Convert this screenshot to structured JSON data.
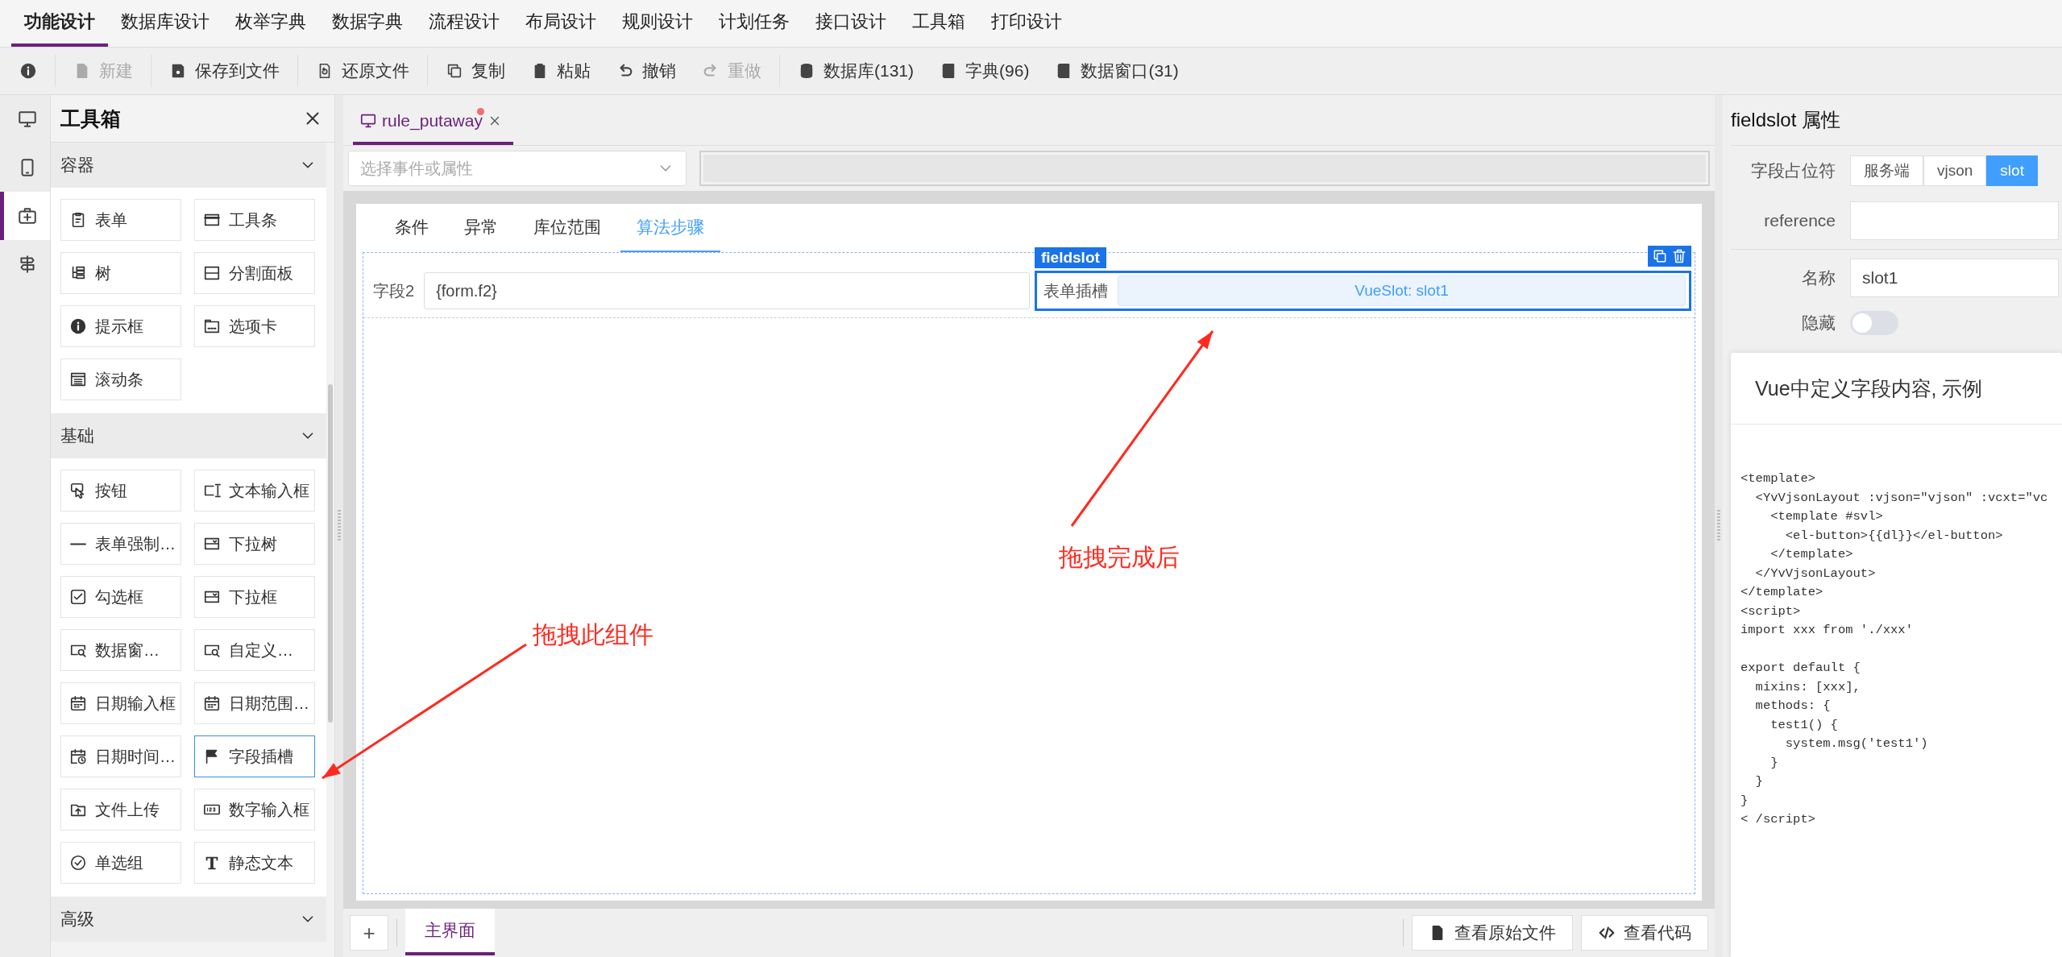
{
  "menu": [
    {
      "label": "功能设计",
      "selected": true
    },
    {
      "label": "数据库设计",
      "selected": false
    },
    {
      "label": "枚举字典",
      "selected": false
    },
    {
      "label": "数据字典",
      "selected": false
    },
    {
      "label": "流程设计",
      "selected": false
    },
    {
      "label": "布局设计",
      "selected": false
    },
    {
      "label": "规则设计",
      "selected": false
    },
    {
      "label": "计划任务",
      "selected": false
    },
    {
      "label": "接口设计",
      "selected": false
    },
    {
      "label": "工具箱",
      "selected": false
    },
    {
      "label": "打印设计",
      "selected": false
    }
  ],
  "toolbar": [
    [
      {
        "disabled": false
      }
    ],
    [
      {
        "label": "新建",
        "disabled": true
      }
    ],
    [
      {
        "label": "保存到文件",
        "disabled": false
      }
    ],
    [
      {
        "label": "还原文件",
        "disabled": false
      }
    ],
    [
      {
        "label": "复制",
        "disabled": false
      },
      {
        "label": "粘贴",
        "disabled": false
      },
      {
        "label": "撤销",
        "disabled": false
      },
      {
        "label": "重做",
        "disabled": true
      }
    ],
    [
      {
        "label": "数据库(131)",
        "disabled": false
      },
      {
        "label": "字典(96)",
        "disabled": false
      },
      {
        "label": "数据窗口(31)",
        "disabled": false
      }
    ]
  ],
  "side_strip": [
    {
      "selected": false
    },
    {
      "selected": false
    },
    {
      "selected": true
    },
    {
      "selected": false
    }
  ],
  "toolbox": {
    "title": "工具箱",
    "sections": [
      {
        "title": "容器",
        "expanded": true,
        "items": [
          {
            "label": "表单",
            "selected": false
          },
          {
            "label": "工具条",
            "selected": false
          },
          {
            "label": "树",
            "selected": false
          },
          {
            "label": "分割面板",
            "selected": false
          },
          {
            "label": "提示框",
            "selected": false
          },
          {
            "label": "选项卡",
            "selected": false
          },
          {
            "label": "滚动条",
            "selected": false
          }
        ]
      },
      {
        "title": "基础",
        "expanded": true,
        "items": [
          {
            "label": "按钮",
            "selected": false
          },
          {
            "label": "文本输入框",
            "selected": false
          },
          {
            "label": "表单强制…",
            "selected": false
          },
          {
            "label": "下拉树",
            "selected": false
          },
          {
            "label": "勾选框",
            "selected": false
          },
          {
            "label": "下拉框",
            "selected": false
          },
          {
            "label": "数据窗…",
            "selected": false
          },
          {
            "label": "自定义…",
            "selected": false
          },
          {
            "label": "日期输入框",
            "selected": false
          },
          {
            "label": "日期范围…",
            "selected": false
          },
          {
            "label": "日期时间…",
            "selected": false
          },
          {
            "label": "字段插槽",
            "selected": true
          },
          {
            "label": "文件上传",
            "selected": false
          },
          {
            "label": "数字输入框",
            "selected": false
          },
          {
            "label": "单选组",
            "selected": false
          },
          {
            "label": "静态文本",
            "selected": false
          }
        ]
      },
      {
        "title": "高级",
        "expanded": true
      }
    ]
  },
  "doc_tabs": [
    {
      "label": "rule_putaway",
      "modified": true,
      "selected": true
    }
  ],
  "event_select": {
    "placeholder": "选择事件或属性"
  },
  "form_tabs": [
    {
      "label": "条件",
      "selected": false
    },
    {
      "label": "异常",
      "selected": false
    },
    {
      "label": "库位范围",
      "selected": false
    },
    {
      "label": "算法步骤",
      "selected": true
    }
  ],
  "form_row": {
    "field": {
      "label": "字段2",
      "value": "{form.f2}"
    },
    "slot": {
      "tag": "fieldslot",
      "label": "表单插槽",
      "value": "VueSlot: slot1",
      "selected": true
    }
  },
  "properties": {
    "title": "fieldslot 属性",
    "placeholder_type": {
      "label": "字段占位符",
      "options": [
        {
          "label": "服务端",
          "selected": false
        },
        {
          "label": "vjson",
          "selected": false
        },
        {
          "label": "slot",
          "selected": true
        }
      ]
    },
    "reference": {
      "label": "reference"
    },
    "name": {
      "label": "名称",
      "value": "slot1"
    },
    "hidden": {
      "label": "隐藏",
      "on": false
    }
  },
  "help": {
    "title": "Vue中定义字段内容, 示例",
    "code": "<template>\n  <YvVjsonLayout :vjson=\"vjson\" :vcxt=\"vc\n    <template #svl>\n      <el-button>{{dl}}</el-button>\n    </template>\n  </YvVjsonLayout>\n</template>\n<script>\nimport xxx from './xxx'\n\nexport default {\n  mixins: [xxx],\n  methods: {\n    test1() {\n      system.msg('test1')\n    }\n  }\n}\n< /script>"
  },
  "bottom": {
    "add": "+",
    "pages": [
      {
        "label": "主界面",
        "selected": true
      }
    ],
    "buttons": [
      "查看原始文件",
      "查看代码"
    ]
  },
  "annotations": [
    {
      "text": "拖拽此组件"
    },
    {
      "text": "拖拽完成后"
    }
  ]
}
